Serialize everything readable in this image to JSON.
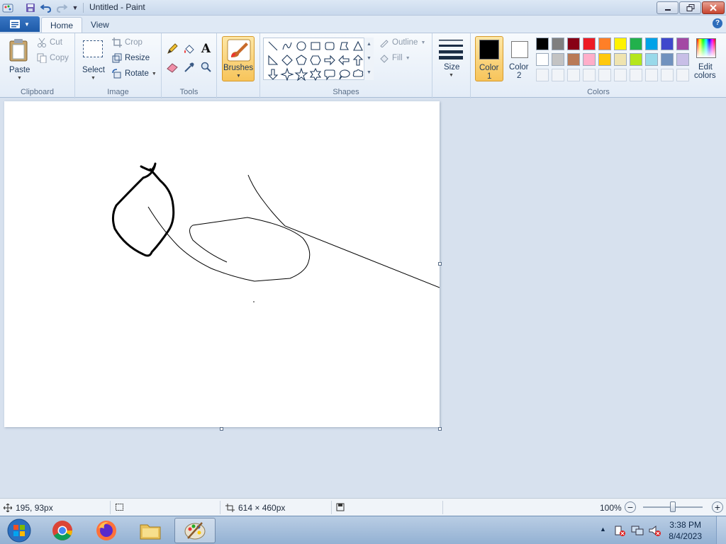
{
  "window": {
    "title": "Untitled - Paint"
  },
  "tabs": {
    "home": "Home",
    "view": "View"
  },
  "clipboard": {
    "paste": "Paste",
    "cut": "Cut",
    "copy": "Copy",
    "group": "Clipboard"
  },
  "image": {
    "select": "Select",
    "crop": "Crop",
    "resize": "Resize",
    "rotate": "Rotate",
    "group": "Image"
  },
  "tools": {
    "group": "Tools"
  },
  "brushes": {
    "label": "Brushes"
  },
  "shapes": {
    "outline": "Outline",
    "fill": "Fill",
    "group": "Shapes"
  },
  "size": {
    "label": "Size"
  },
  "colors": {
    "color1_a": "Color",
    "color1_b": "1",
    "color2_a": "Color",
    "color2_b": "2",
    "edit_a": "Edit",
    "edit_b": "colors",
    "group": "Colors",
    "color1_value": "#000000",
    "color2_value": "#ffffff",
    "palette_row1": [
      "#000000",
      "#7f7f7f",
      "#880015",
      "#ed1c24",
      "#ff7f27",
      "#fff200",
      "#22b14c",
      "#00a2e8",
      "#3f48cc",
      "#a349a4"
    ],
    "palette_row2": [
      "#ffffff",
      "#c3c3c3",
      "#b97a57",
      "#ffaec9",
      "#ffc90e",
      "#efe4b0",
      "#b5e61d",
      "#99d9ea",
      "#7092be",
      "#c8bfe7"
    ]
  },
  "status": {
    "cursor_pos": "195, 93px",
    "canvas_size": "614 × 460px",
    "zoom": "100%",
    "zoom_fraction": 0.5
  },
  "taskbar": {
    "time": "3:38 PM",
    "date": "8/4/2023"
  }
}
